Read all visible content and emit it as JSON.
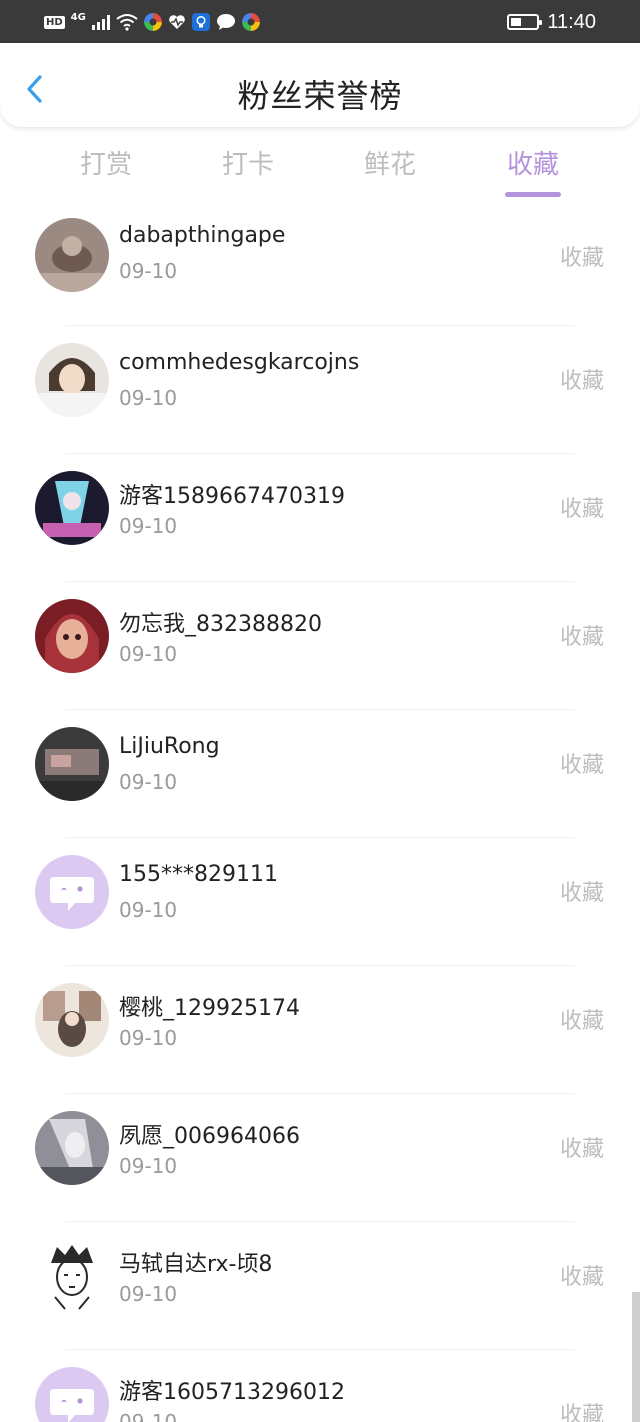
{
  "status_bar": {
    "hd": "HD",
    "network": "4G",
    "time": "11:40",
    "battery_level": 0.4
  },
  "header": {
    "title": "粉丝荣誉榜",
    "back_icon": "chevron-left-icon"
  },
  "tabs": [
    {
      "label": "打赏",
      "active": false
    },
    {
      "label": "打卡",
      "active": false
    },
    {
      "label": "鲜花",
      "active": false
    },
    {
      "label": "收藏",
      "active": true
    }
  ],
  "colors": {
    "accent": "#b493dc",
    "back_arrow": "#3a9ee8",
    "muted": "#bdbdbd"
  },
  "fans": [
    {
      "name": "dabapthingape",
      "date": "09-10",
      "action": "收藏",
      "avatar": "photo-brown"
    },
    {
      "name": "commhedesgkarcojns",
      "date": "09-10",
      "action": "收藏",
      "avatar": "photo-girl"
    },
    {
      "name": "游客1589667470319",
      "date": "09-10",
      "action": "收藏",
      "avatar": "photo-anime-blue"
    },
    {
      "name": "勿忘我_832388820",
      "date": "09-10",
      "action": "收藏",
      "avatar": "photo-anime-red"
    },
    {
      "name": "LiJiuRong",
      "date": "09-10",
      "action": "收藏",
      "avatar": "photo-dark"
    },
    {
      "name": "155***829111",
      "date": "09-10",
      "action": "收藏",
      "avatar": "default-chat"
    },
    {
      "name": "樱桃_129925174",
      "date": "09-10",
      "action": "收藏",
      "avatar": "photo-beige"
    },
    {
      "name": "夙愿_006964066",
      "date": "09-10",
      "action": "收藏",
      "avatar": "photo-grey"
    },
    {
      "name": "马轼自达rx-顷8",
      "date": "09-10",
      "action": "收藏",
      "avatar": "photo-sketch"
    },
    {
      "name": "游客1605713296012",
      "date": "09-10",
      "action": "收藏",
      "avatar": "default-chat"
    }
  ]
}
